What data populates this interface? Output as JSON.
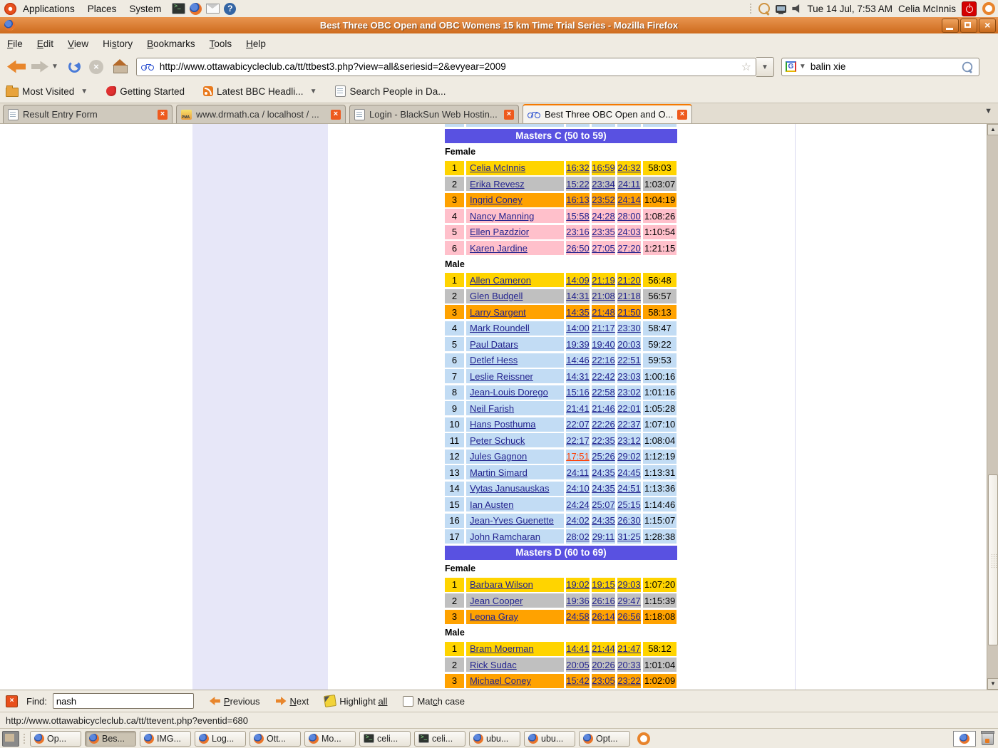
{
  "top_panel": {
    "menus": [
      "Applications",
      "Places",
      "System"
    ],
    "clock": "Tue 14 Jul, 7:53 AM",
    "user": "Celia McInnis"
  },
  "titlebar": {
    "title": "Best Three OBC Open and OBC Womens 15 km Time Trial Series - Mozilla Firefox"
  },
  "menubar": [
    {
      "pre": "",
      "u": "F",
      "post": "ile"
    },
    {
      "pre": "",
      "u": "E",
      "post": "dit"
    },
    {
      "pre": "",
      "u": "V",
      "post": "iew"
    },
    {
      "pre": "Hi",
      "u": "s",
      "post": "tory"
    },
    {
      "pre": "",
      "u": "B",
      "post": "ookmarks"
    },
    {
      "pre": "",
      "u": "T",
      "post": "ools"
    },
    {
      "pre": "",
      "u": "H",
      "post": "elp"
    }
  ],
  "navbar": {
    "url": "http://www.ottawabicycleclub.ca/tt/ttbest3.php?view=all&seriesid=2&evyear=2009",
    "search_engine": "G",
    "search_value": "balin xie"
  },
  "bookmarks": [
    {
      "label": "Most Visited",
      "icon": "folder-icon",
      "caret": true
    },
    {
      "label": "Getting Started",
      "icon": "getting-started-icon",
      "caret": false
    },
    {
      "label": "Latest BBC Headli...",
      "icon": "rss-icon",
      "caret": true
    },
    {
      "label": "Search People in Da...",
      "icon": "page-icon",
      "caret": false
    }
  ],
  "tabs": [
    {
      "title": "Result Entry Form",
      "icon": "page-icon",
      "active": false
    },
    {
      "title": "www.drmath.ca / localhost / ...",
      "icon": "pma-icon",
      "active": false
    },
    {
      "title": "Login - BlackSun Web Hostin...",
      "icon": "page-icon",
      "active": false
    },
    {
      "title": "Best Three OBC Open and O...",
      "icon": "bicycle-icon",
      "active": true
    }
  ],
  "results": {
    "colors": {
      "header_bg": "#5951E1",
      "rank1": "#FFD400",
      "rank2": "#C0C0C0",
      "rank3": "#FFA200",
      "female_bg": "#FFC0CB",
      "male_bg": "#C2DCF4",
      "link": "#23238E",
      "highlight_link": "#FF3D00"
    },
    "sections": [
      {
        "header": "Masters C (50 to 59)",
        "groups": [
          {
            "label": "Female",
            "rows": [
              {
                "pos": "1",
                "name": "Celia McInnis",
                "times": [
                  "16:32",
                  "16:59",
                  "24:32"
                ],
                "total": "58:03"
              },
              {
                "pos": "2",
                "name": "Erika Revesz",
                "times": [
                  "15:22",
                  "23:34",
                  "24:11"
                ],
                "total": "1:03:07"
              },
              {
                "pos": "3",
                "name": "Ingrid Coney",
                "times": [
                  "16:13",
                  "23:52",
                  "24:14"
                ],
                "total": "1:04:19"
              },
              {
                "pos": "4",
                "name": "Nancy Manning",
                "times": [
                  "15:58",
                  "24:28",
                  "28:00"
                ],
                "total": "1:08:26"
              },
              {
                "pos": "5",
                "name": "Ellen Pazdzior",
                "times": [
                  "23:16",
                  "23:35",
                  "24:03"
                ],
                "total": "1:10:54"
              },
              {
                "pos": "6",
                "name": "Karen Jardine",
                "times": [
                  "26:50",
                  "27:05",
                  "27:20"
                ],
                "total": "1:21:15"
              }
            ]
          },
          {
            "label": "Male",
            "rows": [
              {
                "pos": "1",
                "name": "Allen Cameron",
                "times": [
                  "14:09",
                  "21:19",
                  "21:20"
                ],
                "total": "56:48"
              },
              {
                "pos": "2",
                "name": "Glen Budgell",
                "times": [
                  "14:31",
                  "21:08",
                  "21:18"
                ],
                "total": "56:57"
              },
              {
                "pos": "3",
                "name": "Larry Sargent",
                "times": [
                  "14:35",
                  "21:48",
                  "21:50"
                ],
                "total": "58:13"
              },
              {
                "pos": "4",
                "name": "Mark Roundell",
                "times": [
                  "14:00",
                  "21:17",
                  "23:30"
                ],
                "total": "58:47"
              },
              {
                "pos": "5",
                "name": "Paul Datars",
                "times": [
                  "19:39",
                  "19:40",
                  "20:03"
                ],
                "total": "59:22"
              },
              {
                "pos": "6",
                "name": "Detlef Hess",
                "times": [
                  "14:46",
                  "22:16",
                  "22:51"
                ],
                "total": "59:53"
              },
              {
                "pos": "7",
                "name": "Leslie Reissner",
                "times": [
                  "14:31",
                  "22:42",
                  "23:03"
                ],
                "total": "1:00:16"
              },
              {
                "pos": "8",
                "name": "Jean-Louis Dorego",
                "times": [
                  "15:16",
                  "22:58",
                  "23:02"
                ],
                "total": "1:01:16"
              },
              {
                "pos": "9",
                "name": "Neil Farish",
                "times": [
                  "21:41",
                  "21:46",
                  "22:01"
                ],
                "total": "1:05:28"
              },
              {
                "pos": "10",
                "name": "Hans Posthuma",
                "times": [
                  "22:07",
                  "22:26",
                  "22:37"
                ],
                "total": "1:07:10"
              },
              {
                "pos": "11",
                "name": "Peter Schuck",
                "times": [
                  "22:17",
                  "22:35",
                  "23:12"
                ],
                "total": "1:08:04"
              },
              {
                "pos": "12",
                "name": "Jules Gagnon",
                "times": [
                  "17:51",
                  "25:26",
                  "29:02"
                ],
                "total": "1:12:19",
                "highlight_time": 0
              },
              {
                "pos": "13",
                "name": "Martin Simard",
                "times": [
                  "24:11",
                  "24:35",
                  "24:45"
                ],
                "total": "1:13:31"
              },
              {
                "pos": "14",
                "name": "Vytas Janusauskas",
                "times": [
                  "24:10",
                  "24:35",
                  "24:51"
                ],
                "total": "1:13:36"
              },
              {
                "pos": "15",
                "name": "Ian Austen",
                "times": [
                  "24:24",
                  "25:07",
                  "25:15"
                ],
                "total": "1:14:46"
              },
              {
                "pos": "16",
                "name": "Jean-Yves Guenette",
                "times": [
                  "24:02",
                  "24:35",
                  "26:30"
                ],
                "total": "1:15:07"
              },
              {
                "pos": "17",
                "name": "John Ramcharan",
                "times": [
                  "28:02",
                  "29:11",
                  "31:25"
                ],
                "total": "1:28:38"
              }
            ]
          }
        ]
      },
      {
        "header": "Masters D (60 to 69)",
        "groups": [
          {
            "label": "Female",
            "rows": [
              {
                "pos": "1",
                "name": "Barbara Wilson",
                "times": [
                  "19:02",
                  "19:15",
                  "29:03"
                ],
                "total": "1:07:20"
              },
              {
                "pos": "2",
                "name": "Jean Cooper",
                "times": [
                  "19:36",
                  "26:16",
                  "29:47"
                ],
                "total": "1:15:39"
              },
              {
                "pos": "3",
                "name": "Leona Gray",
                "times": [
                  "24:58",
                  "26:14",
                  "26:56"
                ],
                "total": "1:18:08"
              }
            ]
          },
          {
            "label": "Male",
            "rows": [
              {
                "pos": "1",
                "name": "Bram Moerman",
                "times": [
                  "14:41",
                  "21:44",
                  "21:47"
                ],
                "total": "58:12"
              },
              {
                "pos": "2",
                "name": "Rick Sudac",
                "times": [
                  "20:05",
                  "20:26",
                  "20:33"
                ],
                "total": "1:01:04"
              },
              {
                "pos": "3",
                "name": "Michael Coney",
                "times": [
                  "15:42",
                  "23:05",
                  "23:22"
                ],
                "total": "1:02:09"
              }
            ]
          }
        ]
      }
    ]
  },
  "find_bar": {
    "label": "Find:",
    "value": "nash",
    "previous": {
      "pre": "",
      "u": "P",
      "post": "revious"
    },
    "next": {
      "pre": "",
      "u": "N",
      "post": "ext"
    },
    "highlight": {
      "pre": "Highlight ",
      "u": "all",
      "post": ""
    },
    "match_case": {
      "pre": "Mat",
      "u": "c",
      "post": "h case"
    }
  },
  "status_bar": "http://www.ottawabicycleclub.ca/tt/ttevent.php?eventid=680",
  "taskbar": [
    {
      "label": "Op...",
      "icon": "firefox-icon",
      "active": false
    },
    {
      "label": "Bes...",
      "icon": "firefox-icon",
      "active": true
    },
    {
      "label": "IMG...",
      "icon": "firefox-icon",
      "active": false
    },
    {
      "label": "Log...",
      "icon": "firefox-icon",
      "active": false
    },
    {
      "label": "Ott...",
      "icon": "firefox-icon",
      "active": false
    },
    {
      "label": "Mo...",
      "icon": "firefox-icon",
      "active": false
    },
    {
      "label": "celi...",
      "icon": "terminal-icon",
      "active": false
    },
    {
      "label": "celi...",
      "icon": "terminal-icon",
      "active": false
    },
    {
      "label": "ubu...",
      "icon": "firefox-icon",
      "active": false
    },
    {
      "label": "ubu...",
      "icon": "firefox-icon",
      "active": false
    },
    {
      "label": "Opt...",
      "icon": "firefox-icon",
      "active": false
    }
  ]
}
